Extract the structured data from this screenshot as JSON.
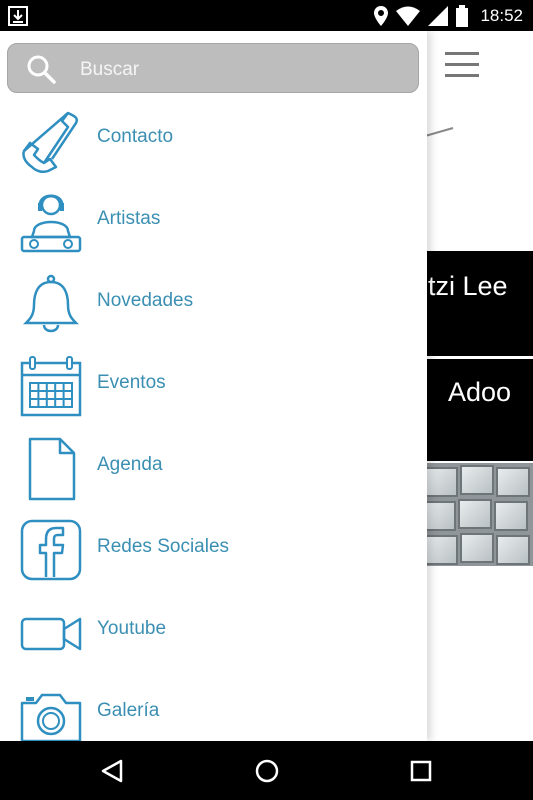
{
  "status_bar": {
    "time": "18:52"
  },
  "search": {
    "placeholder": "Buscar",
    "value": ""
  },
  "menu": {
    "items": [
      {
        "label": "Contacto",
        "icon": "phone-icon"
      },
      {
        "label": "Artistas",
        "icon": "dj-icon"
      },
      {
        "label": "Novedades",
        "icon": "bell-icon"
      },
      {
        "label": "Eventos",
        "icon": "calendar-icon"
      },
      {
        "label": "Agenda",
        "icon": "document-icon"
      },
      {
        "label": "Redes Sociales",
        "icon": "facebook-icon"
      },
      {
        "label": "Youtube",
        "icon": "video-camera-icon"
      },
      {
        "label": "Galería",
        "icon": "camera-icon"
      }
    ]
  },
  "background": {
    "item1": "itzi Lee",
    "item2": "Adoo"
  },
  "colors": {
    "accent": "#3b8fb2",
    "search_bg": "#bdbdbd"
  }
}
